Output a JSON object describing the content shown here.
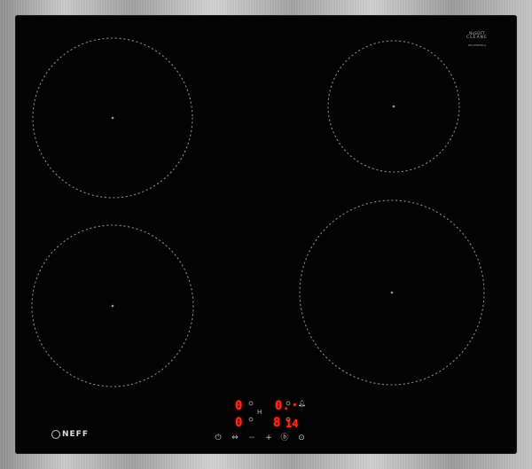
{
  "brand": {
    "top_label_line1": "NoSOFT",
    "top_label_line2": "CLEANE",
    "top_label_small": "SEGOMERKUL",
    "logo_text": "NEFF"
  },
  "cooktop": {
    "zones": [
      {
        "id": "front-left"
      },
      {
        "id": "rear-left"
      },
      {
        "id": "rear-right"
      },
      {
        "id": "front-right"
      }
    ]
  },
  "display": {
    "left_top": "0",
    "left_bottom": "0",
    "right_top": "0.",
    "right_bottom_main": "8",
    "right_bottom_timer": "14",
    "center_mark": "H",
    "accent_color": "#ff2a1a"
  },
  "controls": {
    "power_icon": "power-icon",
    "zone_select_icon": "zone-select-icon",
    "minus_label": "−",
    "plus_label": "+",
    "lock_icon": "lock-icon",
    "timer_icon": "timer-icon",
    "bell_icon": "bell-icon"
  }
}
